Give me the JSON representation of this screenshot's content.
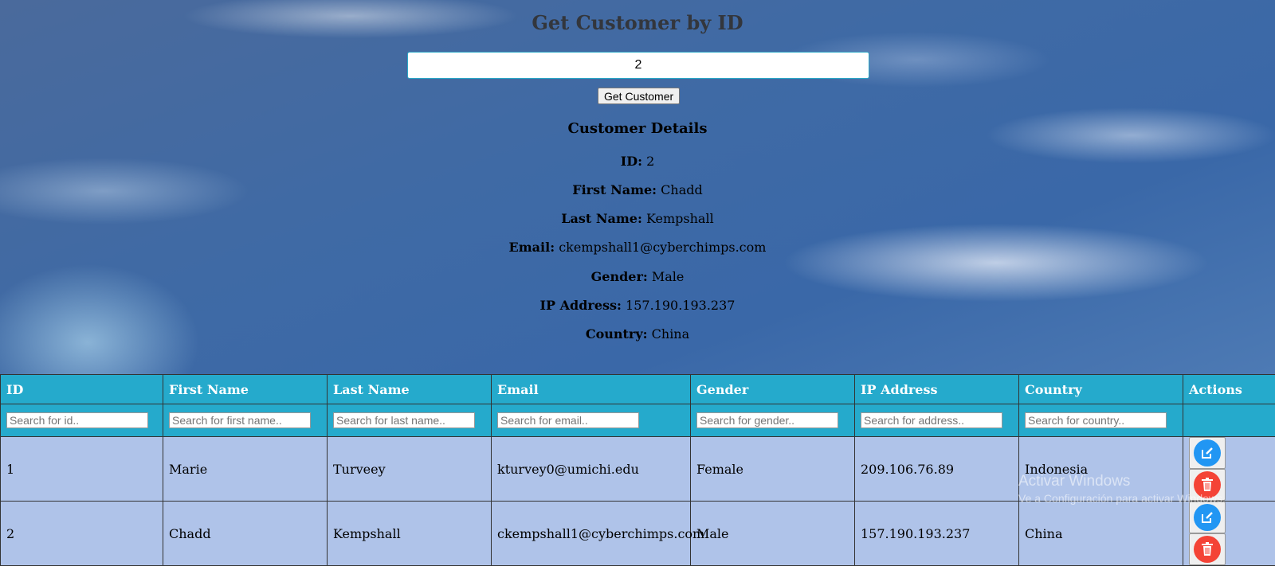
{
  "page": {
    "title": "Get Customer by ID",
    "id_input_value": "2",
    "get_button_label": "Get Customer"
  },
  "details": {
    "heading": "Customer Details",
    "fields": [
      {
        "label": "ID:",
        "value": "2"
      },
      {
        "label": "First Name:",
        "value": "Chadd"
      },
      {
        "label": "Last Name:",
        "value": "Kempshall"
      },
      {
        "label": "Email:",
        "value": "ckempshall1@cyberchimps.com"
      },
      {
        "label": "Gender:",
        "value": "Male"
      },
      {
        "label": "IP Address:",
        "value": "157.190.193.237"
      },
      {
        "label": "Country:",
        "value": "China"
      }
    ]
  },
  "table": {
    "headers": [
      "ID",
      "First Name",
      "Last Name",
      "Email",
      "Gender",
      "IP Address",
      "Country",
      "Actions"
    ],
    "search_placeholders": [
      "Search for id..",
      "Search for first name..",
      "Search for last name..",
      "Search for email..",
      "Search for gender..",
      "Search for address..",
      "Search for country.."
    ],
    "rows": [
      [
        "1",
        "Marie",
        "Turveey",
        "kturvey0@umichi.edu",
        "Female",
        "209.106.76.89",
        "Indonesia"
      ],
      [
        "2",
        "Chadd",
        "Kempshall",
        "ckempshall1@cyberchimps.com",
        "Male",
        "157.190.193.237",
        "China"
      ]
    ],
    "action_icons": [
      "edit-icon",
      "trash-icon"
    ]
  },
  "watermark": {
    "line1": "Activar Windows",
    "line2": "Ve a Configuración para activar Windows."
  },
  "colors": {
    "header_bg": "#25aacc",
    "row_bg": "#afc3e9",
    "edit": "#2196f3",
    "delete": "#f44336"
  }
}
